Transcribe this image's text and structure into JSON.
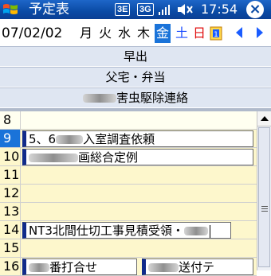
{
  "titlebar": {
    "title": "予定表",
    "battery_label": "3E",
    "network_label": "3G",
    "time": "17:54",
    "close_label": "×"
  },
  "datebar": {
    "date": "07/02/02",
    "days": [
      {
        "label": "月"
      },
      {
        "label": "火"
      },
      {
        "label": "水"
      },
      {
        "label": "木"
      },
      {
        "label": "金",
        "selected": true
      },
      {
        "label": "土"
      },
      {
        "label": "日"
      }
    ]
  },
  "all_day_events": [
    "早出",
    "父宅・弁当",
    "害虫駆除連絡"
  ],
  "hours": [
    "8",
    "9",
    "10",
    "11",
    "12",
    "13",
    "14",
    "15",
    "16"
  ],
  "appointments": {
    "a9": {
      "prefix": "5、6",
      "suffix": "入室調査依頼"
    },
    "a10": {
      "text": "画総合定例"
    },
    "a14": {
      "text": "NT3北間仕切工事見積受領・"
    },
    "a16a": {
      "text": "番打合せ"
    },
    "a16b": {
      "text": "送付テ"
    }
  },
  "colors": {
    "titlebar": "#0a4aa5",
    "selected_day": "#1a73d9",
    "saturday": "#1a4cff",
    "sunday": "#e01010"
  }
}
